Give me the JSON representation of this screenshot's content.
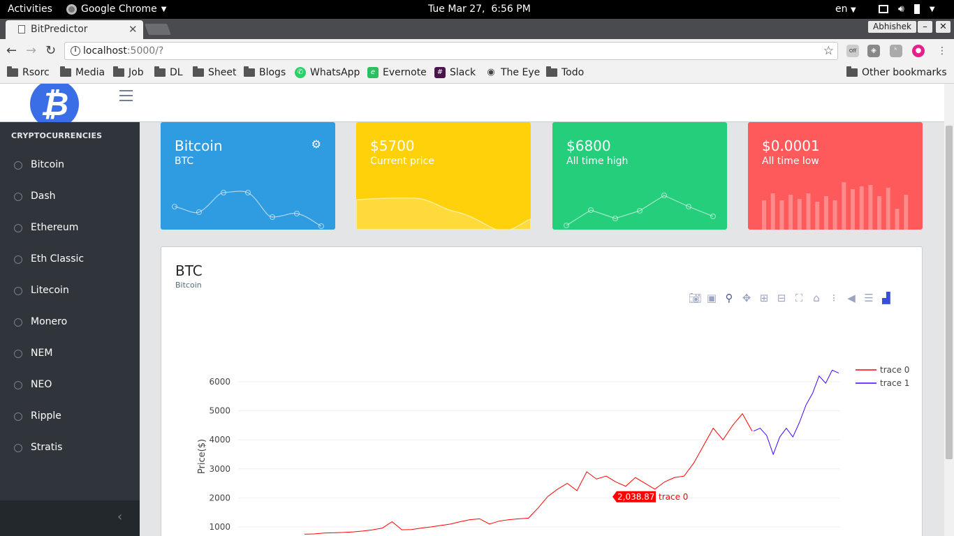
{
  "system": {
    "activities": "Activities",
    "app_name": "Google Chrome",
    "clock": "Tue Mar 27,  6:56 PM",
    "lang": "en"
  },
  "browser": {
    "tab_title": "BitPredictor",
    "profile": "Abhishek",
    "url_host": "localhost",
    "url_rest": ":5000/?",
    "bookmarks": [
      "Rsorc",
      "Media",
      "Job",
      "DL",
      "Sheet",
      "Blogs",
      "WhatsApp",
      "Evernote",
      "Slack",
      "The Eye",
      "Todo"
    ],
    "other_bookmarks": "Other bookmarks",
    "ext_off_badge": "Off"
  },
  "sidebar": {
    "title": "CRYPTOCURRENCIES",
    "items": [
      "Bitcoin",
      "Dash",
      "Ethereum",
      "Eth Classic",
      "Litecoin",
      "Monero",
      "NEM",
      "NEO",
      "Ripple",
      "Stratis"
    ]
  },
  "cards": {
    "bitcoin": {
      "title": "Bitcoin",
      "sub": "BTC",
      "color": "#2f9be0"
    },
    "price": {
      "title": "$5700",
      "sub": "Current price",
      "color": "#fed10a"
    },
    "high": {
      "title": "$6800",
      "sub": "All time high",
      "color": "#24ce7b"
    },
    "low": {
      "title": "$0.0001",
      "sub": "All time low",
      "color": "#fe5a5b"
    }
  },
  "panel": {
    "title": "BTC",
    "subtitle": "Bitcoin"
  },
  "chart_data": {
    "type": "line",
    "ylabel": "Price($)",
    "yticks": [
      1000,
      2000,
      3000,
      4000,
      5000,
      6000
    ],
    "ylim": [
      700,
      6600
    ],
    "grid": true,
    "legend_placement": "top-right",
    "series": [
      {
        "name": "trace 0",
        "color": "#ff0000",
        "values": [
          750,
          760,
          790,
          800,
          810,
          830,
          860,
          900,
          960,
          1180,
          900,
          910,
          960,
          1000,
          1050,
          1100,
          1180,
          1250,
          1280,
          1100,
          1200,
          1250,
          1280,
          1300,
          1650,
          2050,
          2300,
          2500,
          2250,
          2900,
          2650,
          2750,
          2550,
          2400,
          2700,
          2500,
          2300,
          2550,
          2700,
          2750,
          3200,
          3800,
          4400,
          4000,
          4500,
          4900,
          4300
        ]
      },
      {
        "name": "trace 1",
        "color": "#4400ff",
        "values": [
          4300,
          4400,
          4150,
          3500,
          4100,
          4400,
          4100,
          4600,
          5200,
          5600,
          6200,
          5950,
          6400,
          6300
        ]
      }
    ],
    "hover_label": {
      "value": "2,038.87",
      "trace": "trace 0"
    }
  }
}
